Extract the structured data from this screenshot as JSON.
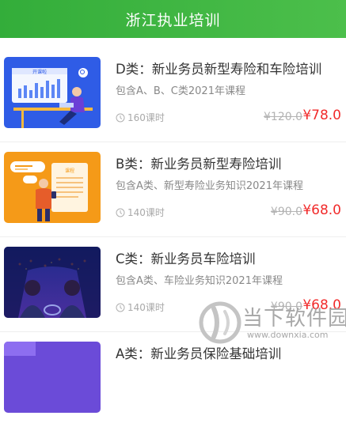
{
  "header": {
    "title": "浙江执业培训"
  },
  "courses": [
    {
      "title": "D类：新业务员新型寿险和车险培训",
      "desc": "包含A、B、C类2021年课程",
      "hours": "160课时",
      "old_price": "¥120.0",
      "price": "¥78.0",
      "thumb_label": "开课啦"
    },
    {
      "title": "B类：新业务员新型寿险培训",
      "desc": "包含A类、新型寿险业务知识2021年课程",
      "hours": "140课时",
      "old_price": "¥90.0",
      "price": "¥68.0",
      "thumb_label": "课程"
    },
    {
      "title": "C类：新业务员车险培训",
      "desc": "包含A类、车险业务知识2021年课程",
      "hours": "140课时",
      "old_price": "¥90.0",
      "price": "¥68.0"
    },
    {
      "title": "A类：新业务员保险基础培训"
    }
  ],
  "watermark": {
    "name": "当下软件园",
    "url": "www.downxia.com"
  },
  "colors": {
    "header": "#3cb33f",
    "price": "#f12b2b",
    "thumb_d": "#2f5ce6",
    "thumb_b": "#f59a18",
    "thumb_c": "#2b2f8f",
    "thumb_a": "#6b4bd8"
  }
}
